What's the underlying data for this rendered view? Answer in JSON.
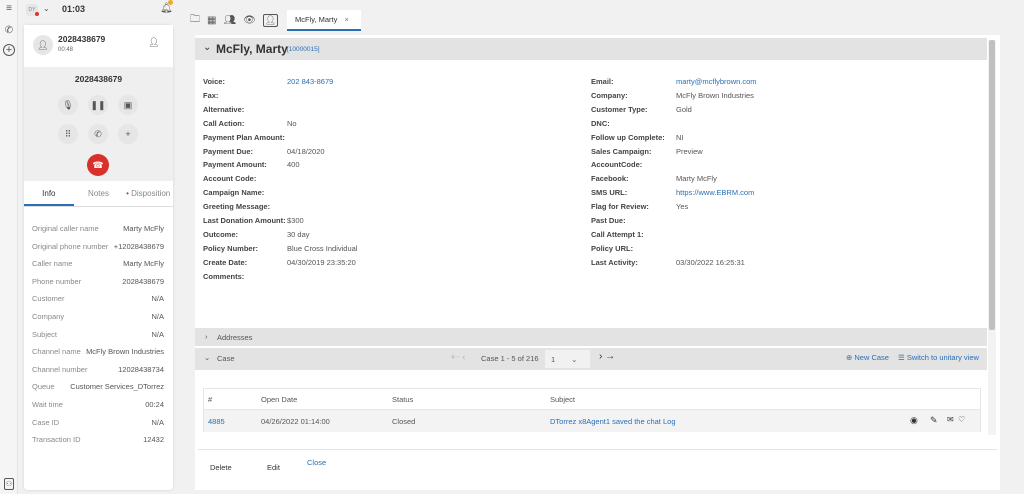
{
  "topbar": {
    "status": "DY",
    "timer": "01:03"
  },
  "call": {
    "number": "2028438679",
    "duration": "00:48",
    "display_number": "2028438679"
  },
  "tabs": [
    "Info",
    "Notes",
    "Disposition"
  ],
  "info": [
    {
      "k": "Original caller name",
      "v": "Marty McFly"
    },
    {
      "k": "Original phone number",
      "v": "+12028438679"
    },
    {
      "k": "Caller name",
      "v": "Marty McFly"
    },
    {
      "k": "Phone number",
      "v": "2028438679"
    },
    {
      "k": "Customer",
      "v": "N/A"
    },
    {
      "k": "Company",
      "v": "N/A"
    },
    {
      "k": "Subject",
      "v": "N/A"
    },
    {
      "k": "Channel name",
      "v": "McFly Brown Industries"
    },
    {
      "k": "Channel number",
      "v": "12028438734"
    },
    {
      "k": "Queue",
      "v": "Customer Services_DTorrez"
    },
    {
      "k": "Wait time",
      "v": "00:24"
    },
    {
      "k": "Case ID",
      "v": "N/A"
    },
    {
      "k": "Transaction ID",
      "v": "12432"
    }
  ],
  "doc_tab": {
    "label": "McFly, Marty",
    "close": "×"
  },
  "contact": {
    "name": "McFly, Marty",
    "id": "[10000015]"
  },
  "left_fields": [
    {
      "k": "Voice:",
      "v": "202 843-8679",
      "link": true
    },
    {
      "k": "Fax:",
      "v": ""
    },
    {
      "k": "Alternative:",
      "v": ""
    },
    {
      "k": "Call Action:",
      "v": "No"
    },
    {
      "k": "Payment Plan Amount:",
      "v": ""
    },
    {
      "k": "Payment Due:",
      "v": "04/18/2020"
    },
    {
      "k": "Payment Amount:",
      "v": "400"
    },
    {
      "k": "Account Code:",
      "v": ""
    },
    {
      "k": "Campaign Name:",
      "v": ""
    },
    {
      "k": "Greeting Message:",
      "v": ""
    },
    {
      "k": "Last Donation Amount:",
      "v": "$300"
    },
    {
      "k": "Outcome:",
      "v": "30 day"
    },
    {
      "k": "Policy Number:",
      "v": "Blue Cross Individual"
    },
    {
      "k": "Create Date:",
      "v": "04/30/2019 23:35:20"
    },
    {
      "k": "Comments:",
      "v": ""
    }
  ],
  "right_fields": [
    {
      "k": "Email:",
      "v": "marty@mcflybrown.com",
      "link": true
    },
    {
      "k": "Company:",
      "v": "McFly Brown Industries"
    },
    {
      "k": "Customer Type:",
      "v": "Gold"
    },
    {
      "k": "DNC:",
      "v": ""
    },
    {
      "k": "Follow up Complete:",
      "v": "NI"
    },
    {
      "k": "Sales Campaign:",
      "v": "Preview"
    },
    {
      "k": "AccountCode:",
      "v": ""
    },
    {
      "k": "Facebook:",
      "v": "Marty McFly"
    },
    {
      "k": "SMS URL:",
      "v": "https://www.EBRM.com",
      "link": true
    },
    {
      "k": "Flag for Review:",
      "v": "Yes"
    },
    {
      "k": "Past Due:",
      "v": ""
    },
    {
      "k": "Call Attempt 1:",
      "v": ""
    },
    {
      "k": "Policy URL:",
      "v": ""
    },
    {
      "k": "Last Activity:",
      "v": "03/30/2022 16:25:31"
    }
  ],
  "sections": {
    "addresses": "Addresses",
    "case": "Case"
  },
  "pager": {
    "text": "Case 1 - 5 of 216",
    "page": "1"
  },
  "case_actions": {
    "new": "New Case",
    "switch": "Switch to unitary view"
  },
  "table": {
    "headers": [
      "#",
      "Open Date",
      "Status",
      "Subject"
    ],
    "rows": [
      {
        "id": "4885",
        "date": "04/26/2022 01:14:00",
        "status": "Closed",
        "subject": "DTorrez x8Agent1 saved the chat Log"
      }
    ]
  },
  "footer": {
    "delete": "Delete",
    "edit": "Edit",
    "close": "Close"
  }
}
